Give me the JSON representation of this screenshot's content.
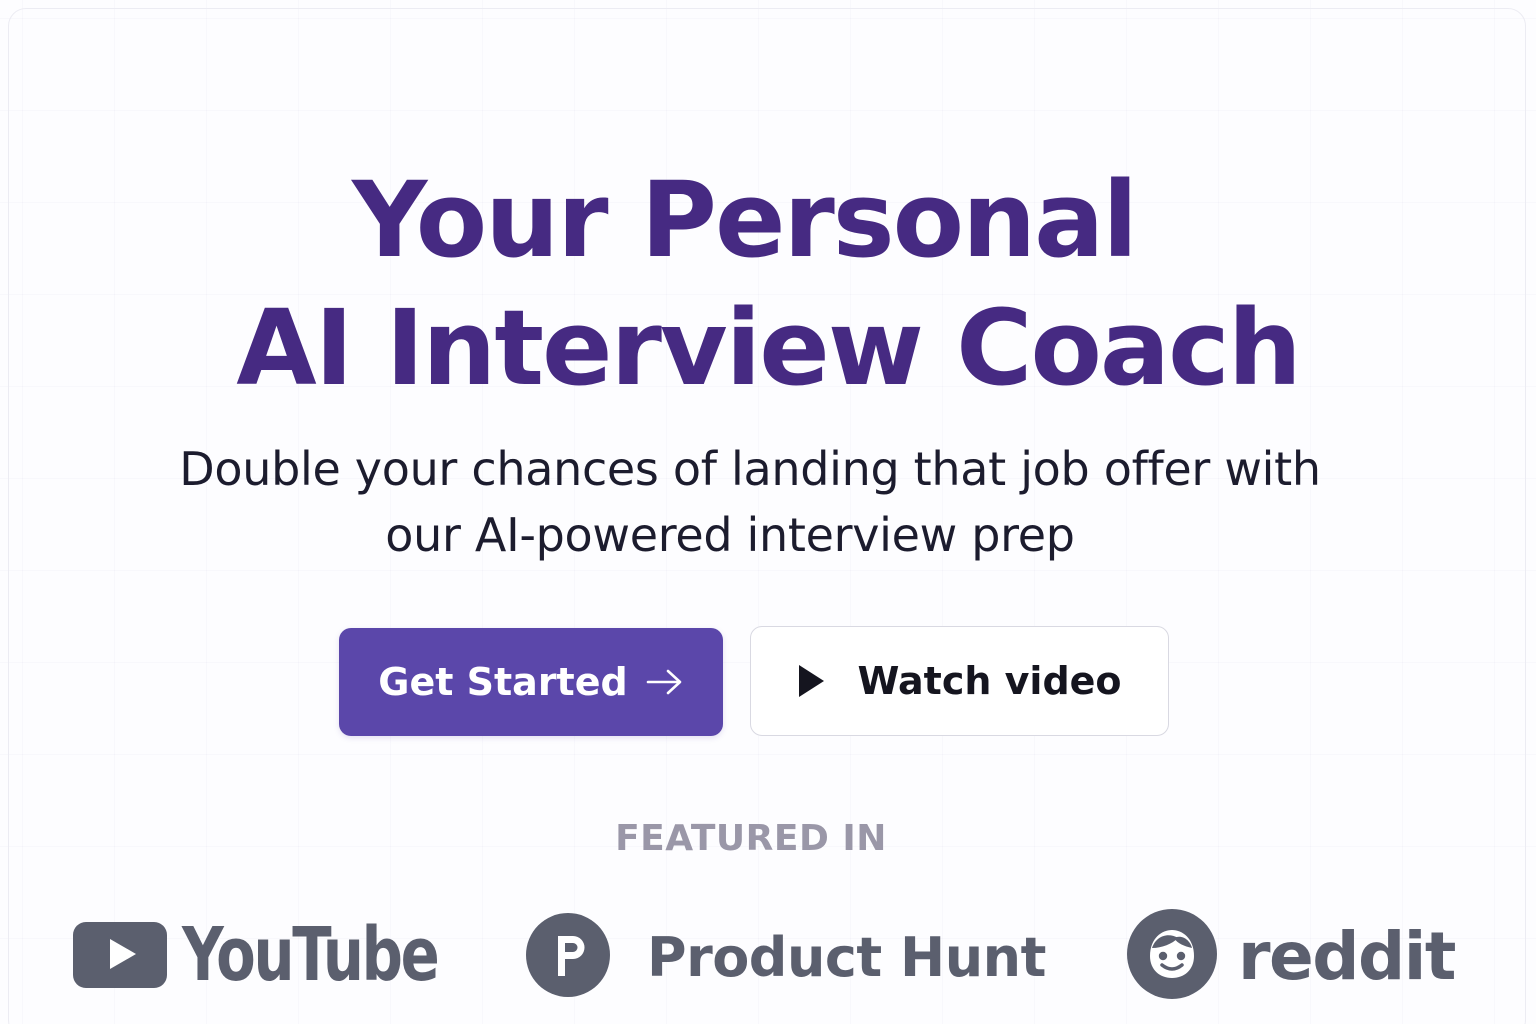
{
  "hero": {
    "title_line_1": "Your Personal",
    "title_line_2": "AI Interview Coach",
    "subtitle_line_1": "Double your chances of landing that job offer with",
    "subtitle_line_2": "our AI-powered interview prep"
  },
  "actions": {
    "primary_label": "Get Started",
    "primary_icon": "arrow-right-icon",
    "secondary_label": "Watch video",
    "secondary_icon": "play-icon"
  },
  "featured": {
    "label": "FEATURED IN",
    "logos": [
      {
        "name": "YouTube",
        "icon": "youtube-icon"
      },
      {
        "name": "Product Hunt",
        "icon": "product-hunt-icon"
      },
      {
        "name": "reddit",
        "icon": "reddit-icon"
      }
    ]
  },
  "colors": {
    "title": "#462a82",
    "primary_button": "#5b47aa",
    "subtitle": "#1c1c2e",
    "featured_label": "#9a97a8",
    "logo_gray": "#5b5f6e"
  }
}
